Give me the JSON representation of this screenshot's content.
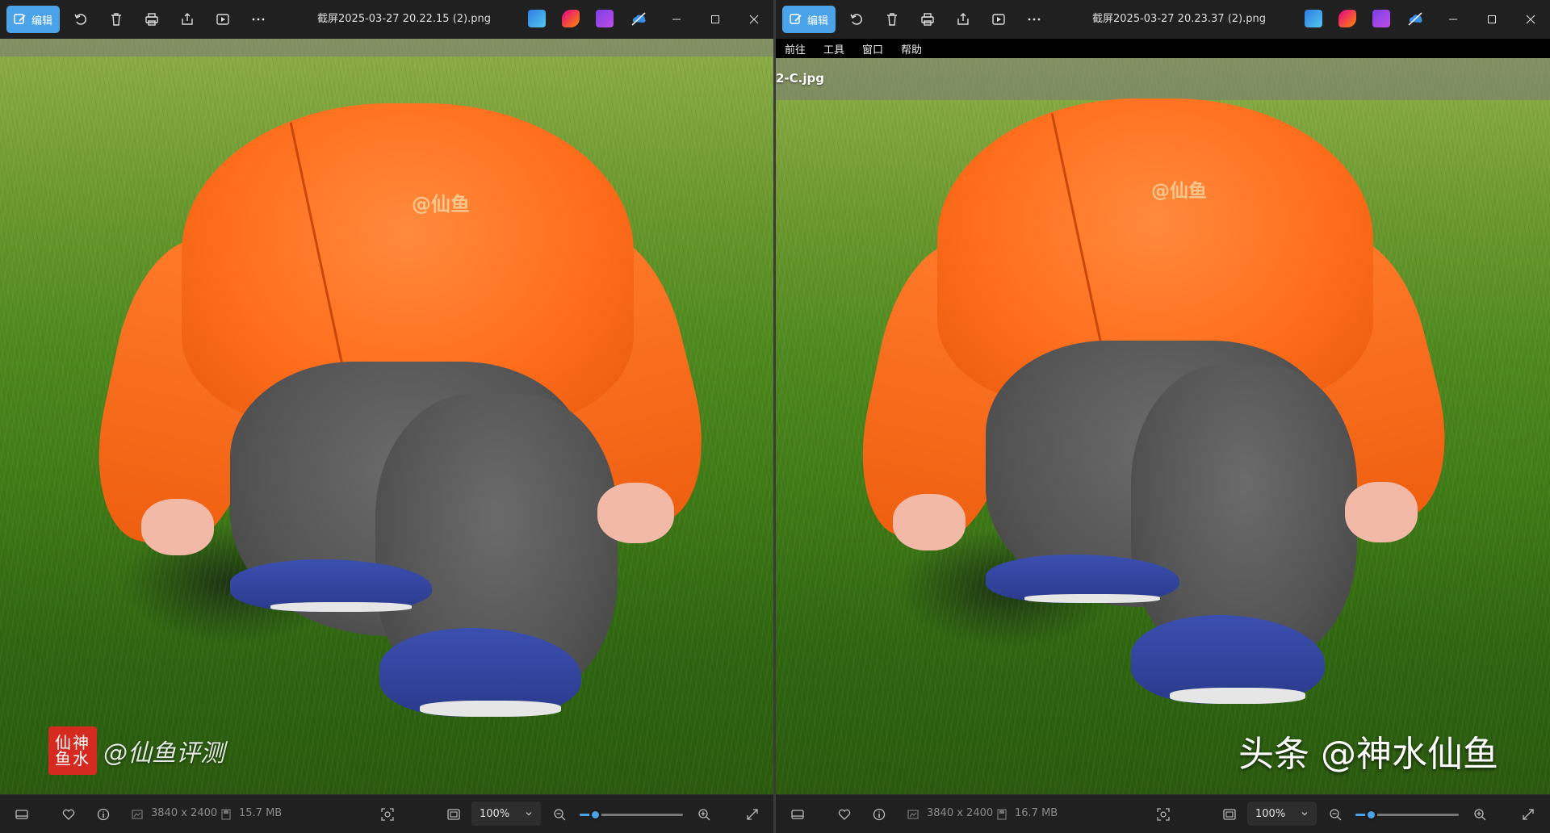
{
  "left": {
    "edit_label": "编辑",
    "file_title": "截屏2025-03-27 20.22.15 (2).png",
    "seal_text": "仙神鱼水",
    "watermark": "@仙鱼评测",
    "jacket_logo": "@仙鱼",
    "dimensions": "3840 x 2400",
    "file_size": "15.7 MB",
    "zoom": "100%",
    "zoom_fraction": 0.15
  },
  "right": {
    "edit_label": "编辑",
    "file_title": "截屏2025-03-27 20.23.37 (2).png",
    "menu": [
      "前往",
      "工具",
      "窗口",
      "帮助"
    ],
    "file_label": "2-C.jpg",
    "jacket_logo": "@仙鱼",
    "watermark": "头条 @神水仙鱼",
    "dimensions": "3840 x 2400",
    "file_size": "16.7 MB",
    "zoom": "100%",
    "zoom_fraction": 0.15
  },
  "colors": {
    "accent": "#4aa3e8",
    "seal": "#d42a1f"
  },
  "icons": [
    "edit-icon",
    "rotate-icon",
    "delete-icon",
    "print-icon",
    "share-icon",
    "slideshow-icon",
    "more-icon",
    "minimize-icon",
    "maximize-icon",
    "close-icon",
    "filmstrip-icon",
    "favorite-icon",
    "info-icon",
    "dimensions-icon",
    "file-size-icon",
    "face-detect-icon",
    "fit-icon",
    "zoom-out-icon",
    "zoom-in-icon",
    "fullscreen-icon"
  ]
}
